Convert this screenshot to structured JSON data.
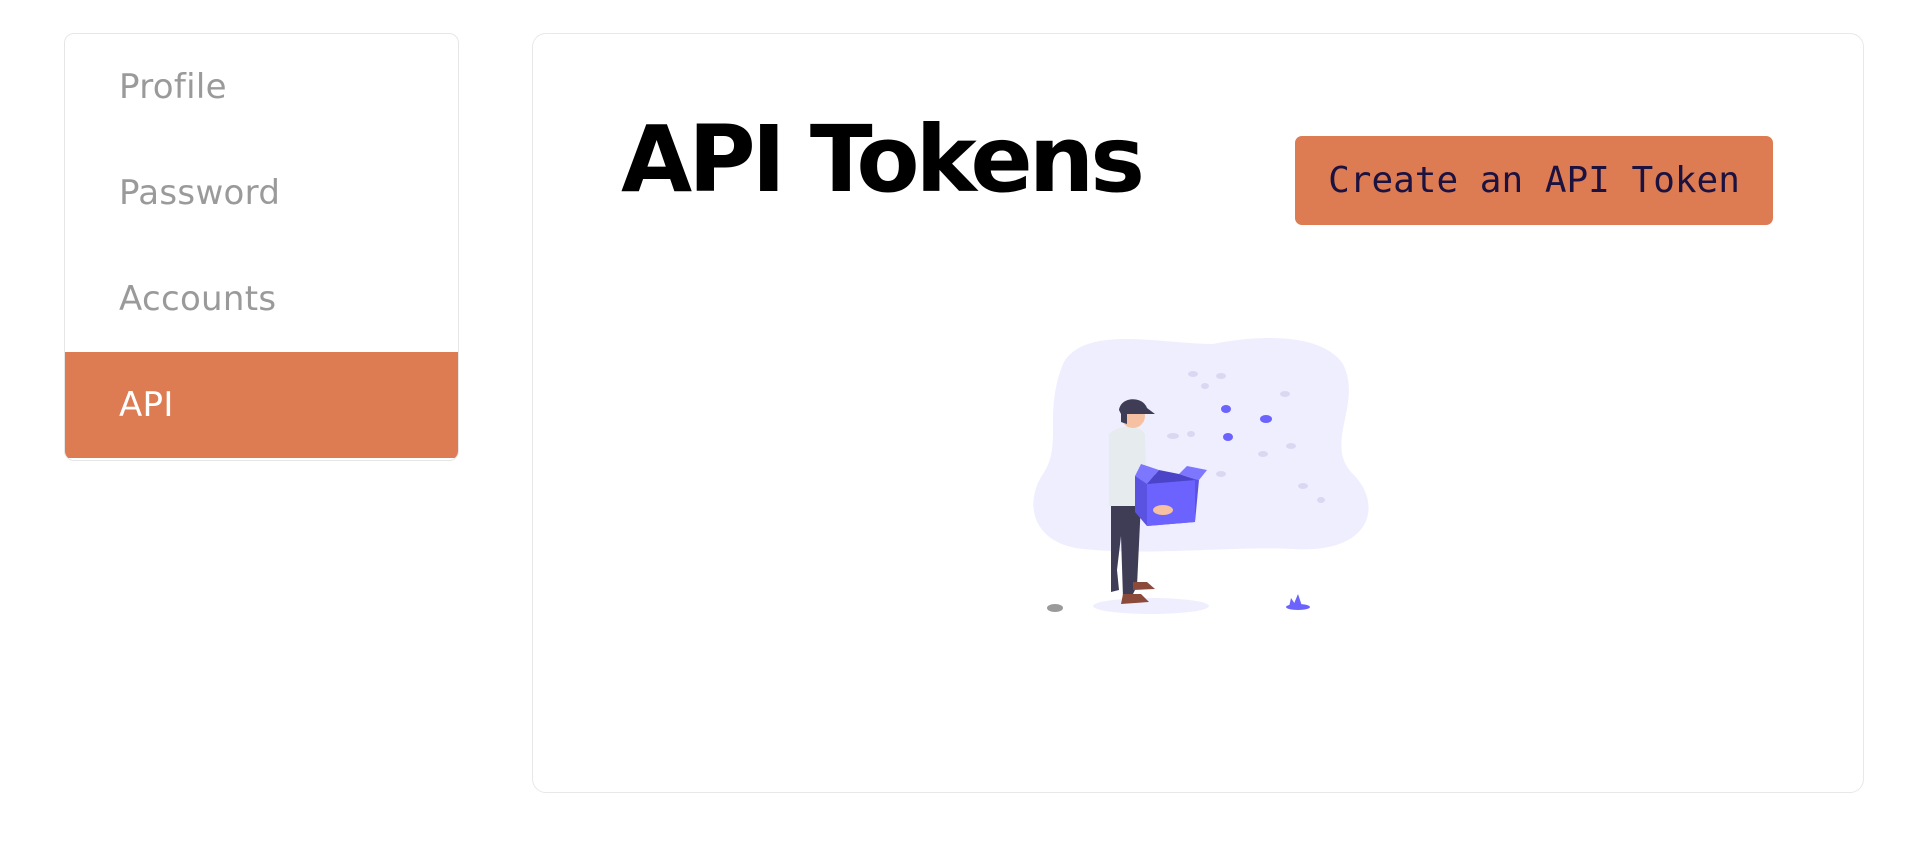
{
  "sidebar": {
    "items": [
      {
        "label": "Profile",
        "active": false
      },
      {
        "label": "Password",
        "active": false
      },
      {
        "label": "Accounts",
        "active": false
      },
      {
        "label": "API",
        "active": true
      }
    ]
  },
  "main": {
    "title": "API Tokens",
    "create_button_label": "Create an API Token",
    "empty_state_illustration": "person-holding-open-box-illustration"
  },
  "colors": {
    "accent": "#dd7b52",
    "button_text": "#1b1240",
    "inactive_nav_text": "#9a9a9a",
    "illustration_purple": "#6c63ff",
    "illustration_blob": "#efeefe"
  }
}
